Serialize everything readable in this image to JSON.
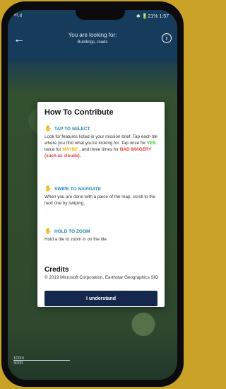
{
  "status": {
    "left": "⁴ᴳ.ıl",
    "right": "✱ 🔋21% 1:57"
  },
  "header": {
    "back_icon": "←",
    "title": "You are looking for:",
    "subtitle": "Buildings, roads",
    "info_icon": "i"
  },
  "modal": {
    "title": "How To Contribute",
    "tap_title": "TAP TO SELECT",
    "tap_body_1": "Look for features listed in your mission brief. Tap each tile where you find what you're looking for. Tap once for ",
    "yes": "YES",
    "tap_body_2": ", twice for ",
    "maybe": "MAYBE",
    "tap_body_3": ", and three times for ",
    "bad": "BAD IMAGERY (such as clouds).",
    "swipe_title": "SWIPE TO NAVIGATE",
    "swipe_body": "When you are done with a piece of the map, scroll to the next one by swiping.",
    "hold_title": "HOLD TO ZOOM",
    "hold_body": "Hold a tile to zoom in on the tile.",
    "credits_title": "Credits",
    "credits_body": "© 2019 Microsoft Corporation, Earthstar Geographics SIO",
    "button_label": "I understand"
  },
  "scale": {
    "line1": "100m",
    "line2": "300ft"
  }
}
